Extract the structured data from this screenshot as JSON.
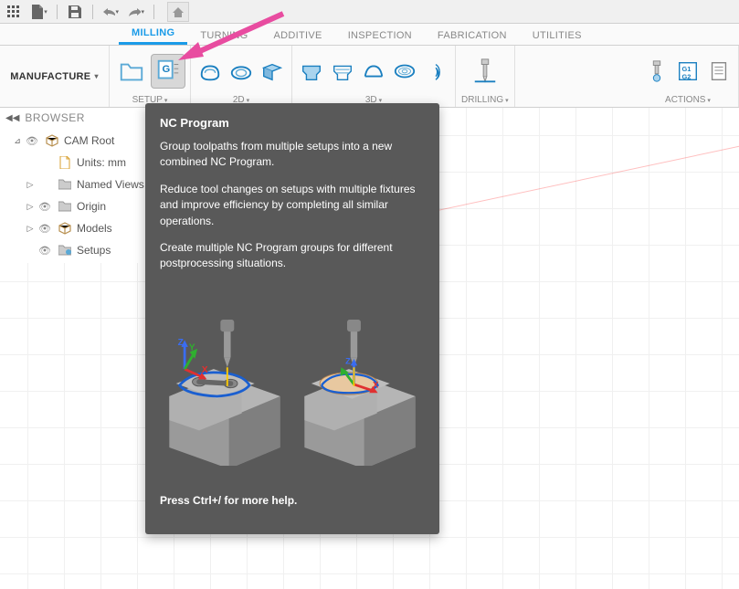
{
  "workspace": "MANUFACTURE",
  "tabs": [
    "MILLING",
    "TURNING",
    "ADDITIVE",
    "INSPECTION",
    "FABRICATION",
    "UTILITIES"
  ],
  "activeTab": "MILLING",
  "groups": {
    "setup": "SETUP",
    "twod": "2D",
    "threed": "3D",
    "drilling": "DRILLING",
    "actions": "ACTIONS"
  },
  "browser": {
    "title": "BROWSER",
    "items": [
      {
        "label": "CAM Root",
        "indent": 1,
        "arrow": "⊿",
        "eye": true,
        "icon": "cube"
      },
      {
        "label": "Units: mm",
        "indent": 2,
        "arrow": "",
        "eye": false,
        "icon": "doc"
      },
      {
        "label": "Named Views",
        "indent": 2,
        "arrow": "▷",
        "eye": false,
        "icon": "folder"
      },
      {
        "label": "Origin",
        "indent": 2,
        "arrow": "▷",
        "eye": true,
        "icon": "folder"
      },
      {
        "label": "Models",
        "indent": 2,
        "arrow": "▷",
        "eye": true,
        "icon": "cube"
      },
      {
        "label": "Setups",
        "indent": 2,
        "arrow": "",
        "eye": true,
        "icon": "setup"
      }
    ]
  },
  "tooltip": {
    "title": "NC Program",
    "p1": "Group toolpaths from multiple setups into a new combined NC Program.",
    "p2": "Reduce tool changes on setups with multiple fixtures and improve efficiency by completing all similar operations.",
    "p3": "Create multiple NC Program groups for different postprocessing situations.",
    "help": "Press Ctrl+/ for more help."
  }
}
